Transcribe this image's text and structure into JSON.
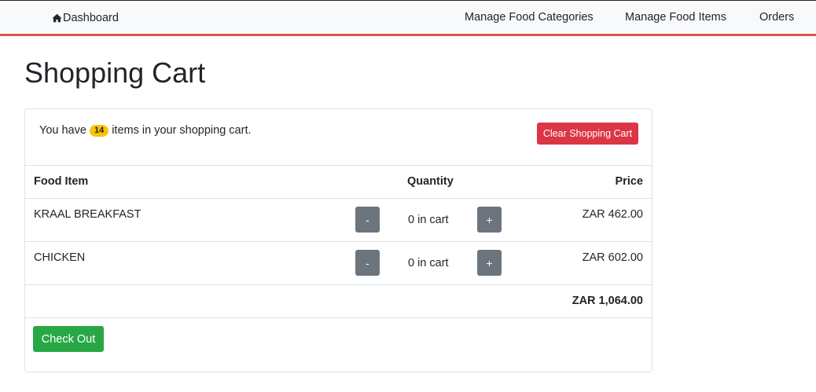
{
  "nav": {
    "brand_label": "Dashboard",
    "brand_icon": "home-icon",
    "links": [
      "Manage Food Categories",
      "Manage Food Items",
      "Orders"
    ]
  },
  "page": {
    "title": "Shopping Cart"
  },
  "cart": {
    "summary_prefix": "You have",
    "item_count": "14",
    "summary_suffix": "items in your shopping cart.",
    "clear_label": "Clear Shopping Cart",
    "headers": {
      "item": "Food Item",
      "quantity": "Quantity",
      "price": "Price"
    },
    "rows": [
      {
        "name": "KRAAL BREAKFAST",
        "minus": "-",
        "quantity": "0 in cart",
        "plus": "+",
        "price": "ZAR 462.00"
      },
      {
        "name": "CHICKEN",
        "minus": "-",
        "quantity": "0 in cart",
        "plus": "+",
        "price": "ZAR 602.00"
      }
    ],
    "total": "ZAR 1,064.00",
    "checkout_label": "Check Out"
  },
  "colors": {
    "accent_red": "#dc3545",
    "nav_underline": "#d9534f",
    "badge": "#ffc107",
    "quantity_button": "#6c757d",
    "checkout_green": "#28a745"
  }
}
